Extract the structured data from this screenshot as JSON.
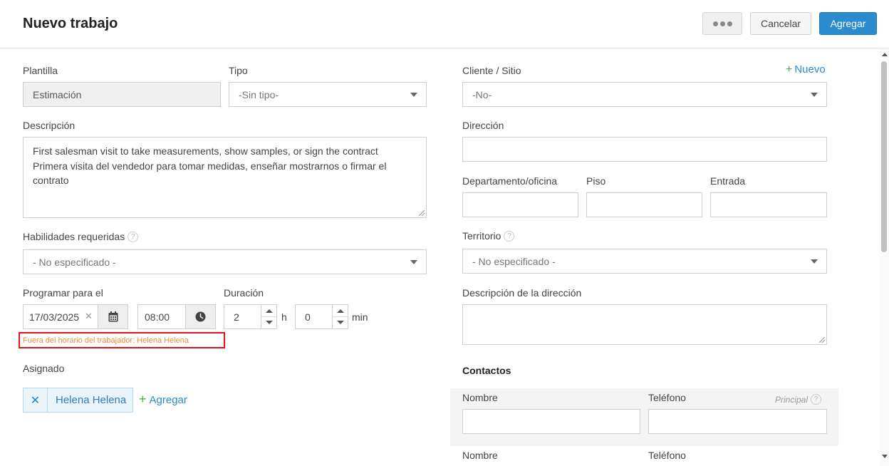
{
  "header": {
    "title": "Nuevo trabajo",
    "cancel_label": "Cancelar",
    "add_label": "Agregar"
  },
  "left": {
    "template_label": "Plantilla",
    "template_value": "Estimación",
    "type_label": "Tipo",
    "type_value": "-Sin tipo-",
    "description_label": "Descripción",
    "description_line1": "First salesman visit to take measurements, show samples, or sign the contract",
    "description_line2": "Primera visita del vendedor para tomar medidas, enseñar mostrarnos o firmar el",
    "description_line3": "contrato",
    "skills_label": "Habilidades requeridas",
    "skills_value": "- No especificado -",
    "schedule_label": "Programar para el",
    "date_value": "17/03/2025",
    "time_value": "08:00",
    "duration_label": "Duración",
    "duration_hours": "2",
    "hours_unit": "h",
    "duration_minutes": "0",
    "minutes_unit": "min",
    "warning": "Fuera del horario del trabajador: Helena Helena",
    "assigned_label": "Asignado",
    "assignee": "Helena Helena",
    "add_assignee": "Agregar"
  },
  "right": {
    "client_label": "Cliente / Sitio",
    "new_link": "Nuevo",
    "client_value": "-No-",
    "address_label": "Dirección",
    "address_value": "",
    "apartment_label": "Departamento/oficina",
    "floor_label": "Piso",
    "entrance_label": "Entrada",
    "territory_label": "Territorio",
    "territory_value": "- No especificado -",
    "address_desc_label": "Descripción de la dirección",
    "contacts_title": "Contactos",
    "contact_name_label": "Nombre",
    "contact_phone_label": "Teléfono",
    "principal_label": "Principal",
    "contact2_name_label": "Nombre",
    "contact2_phone_label": "Teléfono"
  },
  "icons": {
    "help": "?",
    "clear": "✕",
    "remove": "✕",
    "plus": "+"
  }
}
